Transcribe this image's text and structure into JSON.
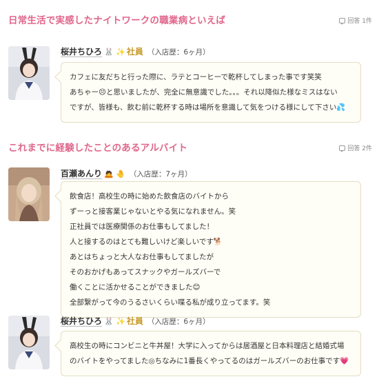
{
  "sections": [
    {
      "title": "日常生活で実感したナイトワークの職業病といえば",
      "count": "回答 1件",
      "posts": [
        {
          "name": "桜井ちひろ",
          "emoji": "🐰 ✨",
          "role": "社員",
          "tenure": "（入店歴：6ヶ月）",
          "lines": [
            "カフェに友だちと行った際に、ラテとコーヒーで乾杯してしまった事です笑笑",
            "あちゃー😣と思いましたが、完全に無意識でした。。。それ以降似た様なミスはない",
            "ですが、皆様も、飲む前に乾杯する時は場所を意識して気をつける様にして下さい💦"
          ]
        }
      ]
    },
    {
      "title": "これまでに経験したことのあるアルバイト",
      "count": "回答 2件",
      "posts": [
        {
          "name": "百瀬あんり",
          "emoji": "🙇 🤚",
          "role": "",
          "tenure": "（入店歴：7ヶ月）",
          "lines": [
            "飲食店！高校生の時に始めた飲食店のバイトから",
            "ずーっと接客業じゃないとやる気になれません。笑",
            "正社員では医療関係のお仕事もしてました！",
            "人と接するのはとても難しいけど楽しいです🐕",
            "あとはちょっと大人なお仕事もしてましたが",
            "そのおかげもあってスナックやガールズバーで",
            "働くことに活かせることができました😊",
            "全部繋がって今のうるさいくらい喋る私が成り立ってます。笑"
          ]
        },
        {
          "name": "桜井ちひろ",
          "emoji": "🐰 ✨",
          "role": "社員",
          "tenure": "（入店歴：6ヶ月）",
          "lines": [
            "高校生の時にコンビニと牛丼屋！大学に入ってからは居酒屋と日本料理店と結婚式場",
            "のバイトをやってました◎ちなみに1番長くやってるのはガールズバーのお仕事です💗"
          ]
        }
      ]
    }
  ]
}
